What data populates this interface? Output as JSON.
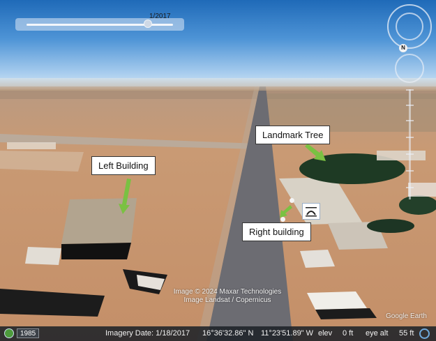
{
  "time_slider": {
    "date_label": "1/2017",
    "position": 0.83
  },
  "navigation": {
    "north_label": "N"
  },
  "annotations": {
    "left_building": "Left Building",
    "landmark_tree": "Landmark Tree",
    "right_building": "Right building"
  },
  "attribution": {
    "line1": "Image © 2024 Maxar Technologies",
    "line2": "Image Landsat / Copernicus"
  },
  "brand": "Google Earth",
  "status_bar": {
    "year": "1985",
    "imagery_date": "Imagery Date: 1/18/2017",
    "latitude": "16°36'32.86\" N",
    "longitude": "11°23'51.89\" W",
    "elev_label": "elev",
    "elev_value": "0 ft",
    "eye_alt_label": "eye alt",
    "eye_alt_value": "55 ft"
  },
  "colors": {
    "annotation_arrow": "#7ac142",
    "sky_top": "#1f6ab8",
    "ground": "#c89670",
    "road": "#6c6c72"
  },
  "icons": {
    "globe": "globe-icon",
    "placemark": "placemark-icon",
    "compass": "compass-icon",
    "streaming": "streaming-indicator-icon"
  }
}
